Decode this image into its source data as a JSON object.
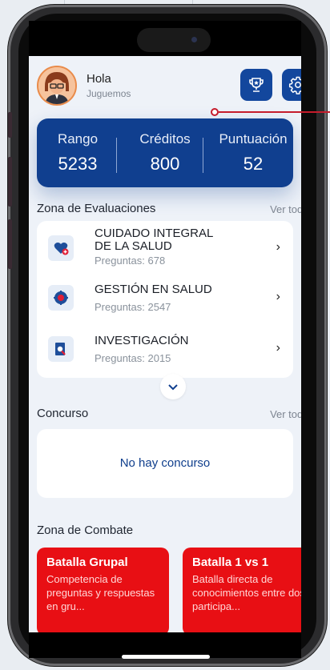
{
  "header": {
    "greeting": "Hola",
    "subtitle": "Juguemos"
  },
  "stats": [
    {
      "label": "Rango",
      "value": "5233"
    },
    {
      "label": "Créditos",
      "value": "800"
    },
    {
      "label": "Puntuación",
      "value": "52"
    }
  ],
  "evaluations": {
    "title": "Zona de Evaluaciones",
    "see_all": "Ver todos",
    "items": [
      {
        "name": "CUIDADO INTEGRAL DE LA SALUD",
        "count": "Preguntas: 678"
      },
      {
        "name": "GESTIÓN EN SALUD",
        "count": "Preguntas: 2547"
      },
      {
        "name": "INVESTIGACIÓN",
        "count": "Preguntas: 2015"
      }
    ]
  },
  "contest": {
    "title": "Concurso",
    "see_all": "Ver todos",
    "empty": "No hay concurso"
  },
  "combat": {
    "title": "Zona de Combate",
    "cards": [
      {
        "title": "Batalla Grupal",
        "desc": "Competencia de preguntas y respuestas en gru..."
      },
      {
        "title": "Batalla 1 vs 1",
        "desc": "Batalla directa de conocimientos entre dos participa..."
      }
    ]
  },
  "colors": {
    "primary": "#103f8f",
    "battle": "#e80f14",
    "annotation": "#c51c2c"
  }
}
